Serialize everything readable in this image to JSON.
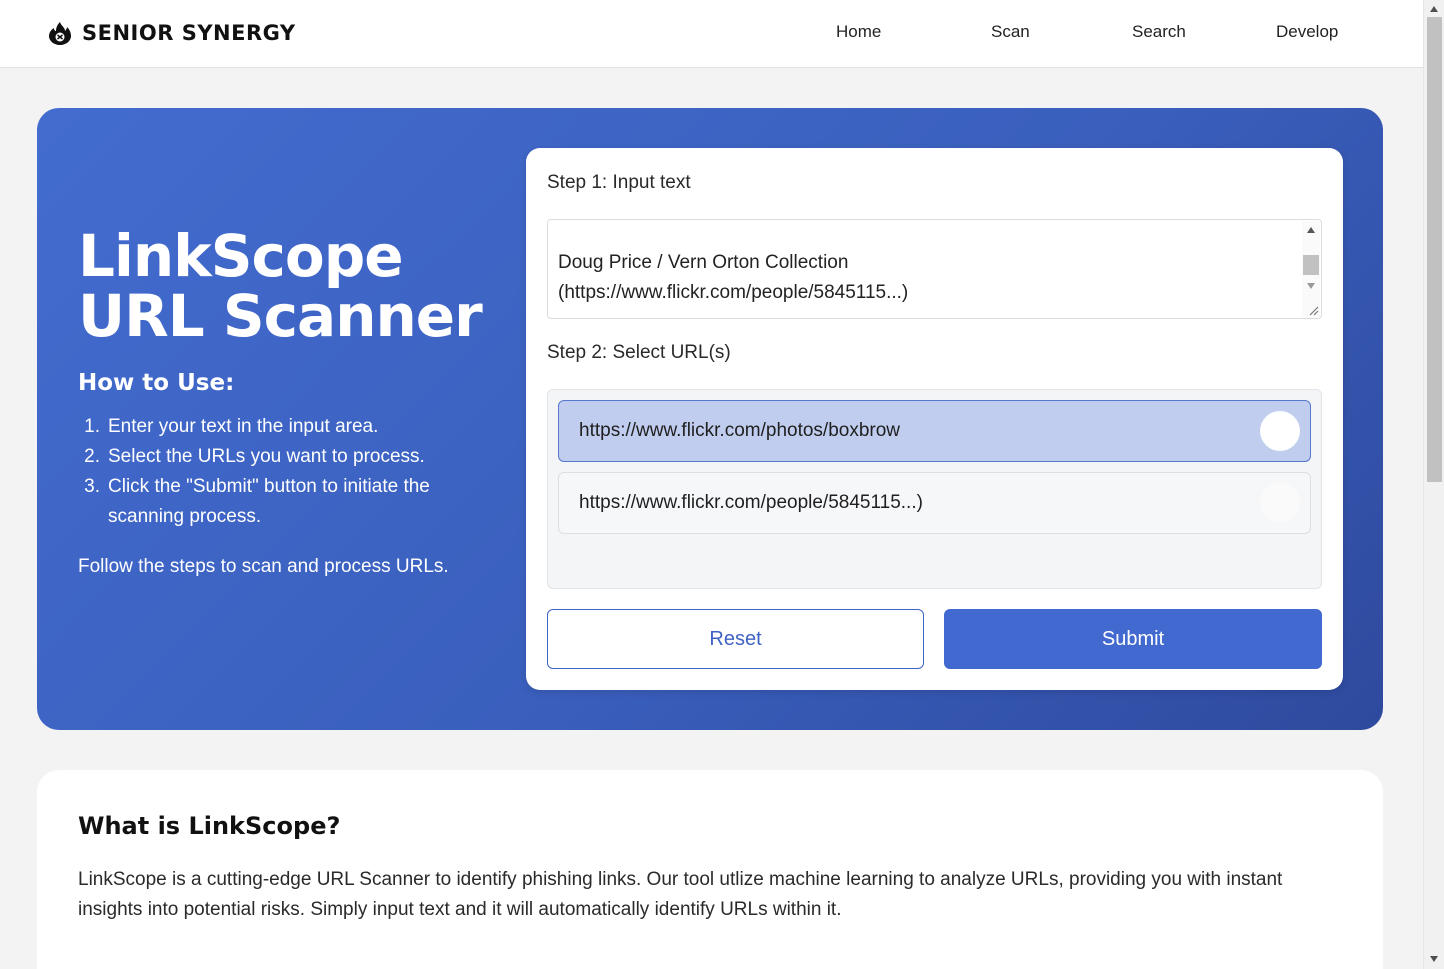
{
  "header": {
    "brand": "SENIOR SYNERGY",
    "brand_icon": "flame-icon",
    "nav": [
      "Home",
      "Scan",
      "Search",
      "Develop"
    ]
  },
  "hero": {
    "title_line1": "LinkScope",
    "title_line2": "URL Scanner",
    "howto_title": "How to Use:",
    "steps": [
      {
        "num": "1.",
        "text": "Enter your text in the input area."
      },
      {
        "num": "2.",
        "text": "Select the URLs you want to process."
      },
      {
        "num": "3.",
        "text": "Click the \"Submit\" button to initiate the scanning process."
      }
    ],
    "follow": "Follow the steps to scan and process URLs."
  },
  "form": {
    "step1_label": "Step 1: Input text",
    "input_text_line1": "Doug Price / Vern Orton Collection",
    "input_text_line2": "(https://www.flickr.com/people/5845115...)",
    "step2_label": "Step 2: Select URL(s)",
    "urls": [
      {
        "url": "https://www.flickr.com/photos/boxbrow",
        "selected": true
      },
      {
        "url": "https://www.flickr.com/people/5845115...)",
        "selected": false
      }
    ],
    "reset_label": "Reset",
    "submit_label": "Submit"
  },
  "about": {
    "title": "What is LinkScope?",
    "body": "LinkScope is a cutting-edge URL Scanner to identify phishing links. Our tool utlize machine learning to analyze URLs, providing you with instant insights into potential risks. Simply input text and it will automatically identify URLs within it."
  },
  "colors": {
    "accent": "#4169cf",
    "hero_gradient_start": "#436ccf",
    "hero_gradient_end": "#2e4a9e",
    "selected_url_bg": "#c0cdef"
  }
}
